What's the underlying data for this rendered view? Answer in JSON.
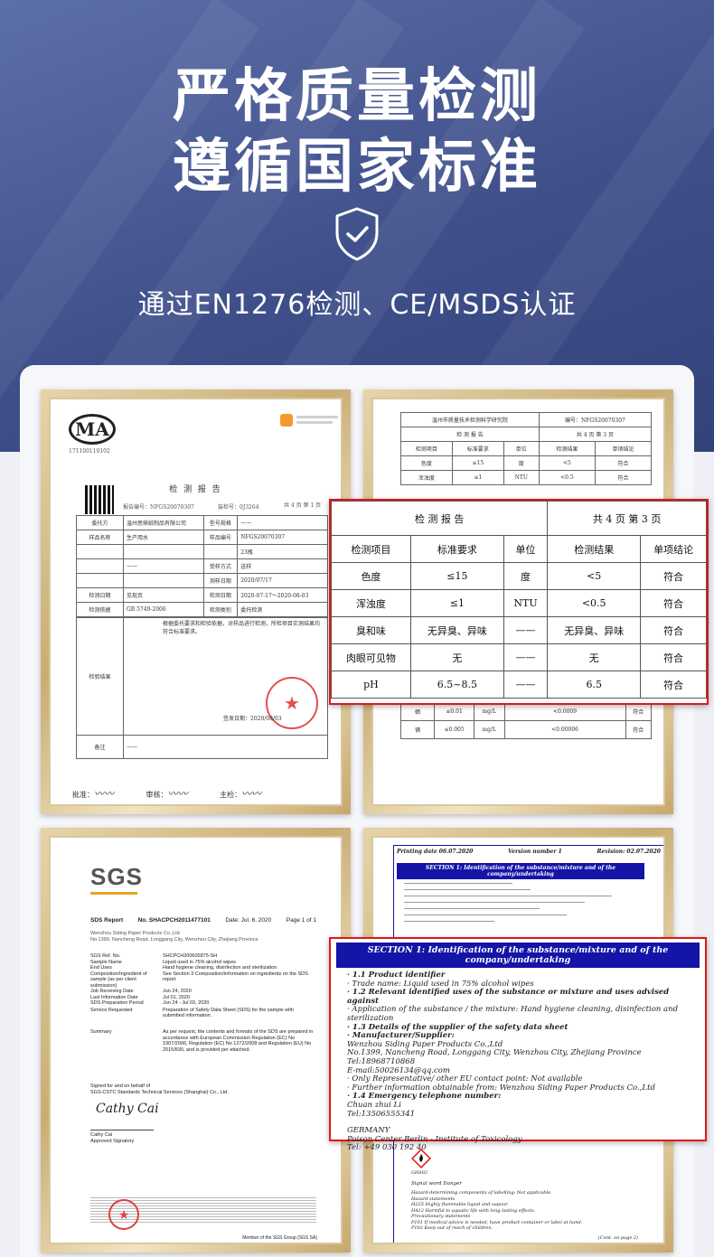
{
  "hero": {
    "title_line1": "严格质量检测",
    "title_line2": "遵循国家标准",
    "subtitle": "通过EN1276检测、CE/MSDS认证",
    "shield_icon": "shield-check-icon"
  },
  "cards": {
    "report1": {
      "logo": "MA",
      "logo_no": "171100110102",
      "title": "检 测 报 告",
      "report_no_label": "报告编号：",
      "report_no": "NFGS20070307",
      "receive_label": "装检号：",
      "receive_no": "0J3264",
      "pages": "共 4 页 第 1 页",
      "rows": [
        [
          "委托方",
          "温州思鼎纸制品有限公司",
          "型号规格",
          "——"
        ],
        [
          "样品名称",
          "生产用水",
          "样品编号",
          "NFGS20070307"
        ],
        [
          "",
          "",
          "",
          "23瓶"
        ],
        [
          "",
          "——",
          "受样方式",
          "送样"
        ],
        [
          "",
          "",
          "测样日期",
          "2020/07/17"
        ],
        [
          "检测日期",
          "见现页",
          "检测日期",
          "2020-07-17～2020-08-03"
        ],
        [
          "检测依据",
          "GB 5749-2006",
          "检测类别",
          "委托检测"
        ]
      ],
      "conclusion_label": "检验结果",
      "conclusion_text": "根据委托要求和检验依据，对样品进行检测，所检项目实测结果均符合标准要求。",
      "issue_date_label": "签发日期：",
      "issue_date": "2020/08/03",
      "remark_label": "备注",
      "remark": "——",
      "sign_labels": [
        "批准：",
        "审核：",
        "主检："
      ]
    },
    "report2": {
      "org": "温州市质量技术检测科学研究院",
      "no": "编号：NFGS20070307",
      "title": "检 测 报 告",
      "pages": "共 4 页 第 3 页",
      "headers": [
        "检测项目",
        "标准要求",
        "单位",
        "检测结果",
        "单项结论"
      ],
      "rows_top": [
        [
          "色度",
          "≤15",
          "度",
          "<5",
          "符合"
        ],
        [
          "浑浊度",
          "≤1",
          "NTU",
          "<0.5",
          "符合"
        ]
      ],
      "rows_bottom": [
        [
          "氟化物",
          "≤1.0",
          "mg/L",
          "未检出（定量限：0.01mg/L）",
          "符合"
        ],
        [
          "氰化物",
          "≤0.05",
          "mg/L",
          "<0.002",
          "符合"
        ],
        [
          "砷",
          "≤0.01",
          "mg/L",
          "<0.0009",
          "符合"
        ],
        [
          "硒",
          "≤0.01",
          "mg/L",
          "<0.0009",
          "符合"
        ],
        [
          "镉",
          "≤0.005",
          "mg/L",
          "<0.00006",
          "符合"
        ]
      ]
    },
    "zoom1": {
      "title": "检 测 报 告",
      "pages": "共 4 页 第 3 页",
      "headers": [
        "检测项目",
        "标准要求",
        "单位",
        "检测结果",
        "单项结论"
      ],
      "rows": [
        [
          "色度",
          "≤15",
          "度",
          "<5",
          "符合"
        ],
        [
          "浑浊度",
          "≤1",
          "NTU",
          "<0.5",
          "符合"
        ],
        [
          "臭和味",
          "无异臭、异味",
          "——",
          "无异臭、异味",
          "符合"
        ],
        [
          "肉眼可见物",
          "无",
          "——",
          "无",
          "符合"
        ],
        [
          "pH",
          "6.5~8.5",
          "——",
          "6.5",
          "符合"
        ]
      ]
    },
    "sgs": {
      "logo": "SGS",
      "report_title": "SDS Report",
      "report_no": "No. SHACPCH2011477101",
      "date": "Date: Jul. 6, 2020",
      "page": "Page 1 of 1",
      "company": "Wenzhou Siding Paper Products Co.,Ltd",
      "address": "No.1399, Nancheng Road, Longgang City, Wenzhou City, Zhejiang Province",
      "fields": [
        [
          "SGS Ref. No.",
          "SHCPCH200605875-SH"
        ],
        [
          "Sample Name",
          "Liquid used in 75% alcohol wipes"
        ],
        [
          "End Uses",
          "Hand hygiene cleaning, disinfection and sterilization"
        ],
        [
          "Composition/Ingredient of sample (as per client submission)",
          "See Section 3 Composition/information on ingredients on the SDS report"
        ],
        [
          "Job Receiving Date",
          "Jun 24, 2020"
        ],
        [
          "Last Information Date",
          "Jul 01, 2020"
        ],
        [
          "SDS Preparation Period",
          "Jun 24 - Jul 03, 2020"
        ]
      ],
      "service_label": "Service Requested",
      "service": "Preparation of Safety Data Sheet (SDS) for the sample with submitted information.",
      "summary_label": "Summary",
      "summary": "As per request, the contents and formats of the SDS are prepared in accordance with European Commission Regulation (EC) No 1907/2006, Regulation (EC) No 1272/2008 and Regulation (EU) No 2015/830, and is provided per attached.",
      "signed": "Signed for and on behalf of",
      "signed_org": "SGS-CSTC Standards Technical Services (Shanghai) Co., Ltd.",
      "signature": "Cathy Cai",
      "signer": "Cathy Cai",
      "signer_title": "Approved Signatory",
      "member": "Member of the SGS Group (SGS SA)"
    },
    "msds": {
      "printing_date": "Printing date 06.07.2020",
      "version": "Version number 1",
      "revision": "Revision: 02.07.2020",
      "section_bar": "SECTION 1: Identification of the substance/mixture and of the company/undertaking",
      "ghs": "GHS02",
      "signal_word": "Signal word Danger",
      "lower_lines": [
        "Hazard-determining components of labelling: Not applicable.",
        "Hazard statements",
        "H225 Highly flammable liquid and vapour.",
        "H412 Harmful to aquatic life with long lasting effects.",
        "Precautionary statements",
        "P101    If medical advice is needed, have product container or label at hand.",
        "P102    Keep out of reach of children."
      ],
      "cont": "(Cont. on page 2)"
    },
    "zoom2": {
      "section_bar": "SECTION 1: Identification of the substance/mixture and of the company/undertaking",
      "lines": [
        {
          "t": "· 1.1 Product identifier",
          "b": true
        },
        {
          "t": "· Trade name: Liquid used in 75% alcohol wipes",
          "b": false
        },
        {
          "t": "· 1.2 Relevant identified uses of the substance or mixture and uses advised against",
          "b": true
        },
        {
          "t": "· Application of the substance / the mixture: Hand hygiene cleaning, disinfection and sterilization",
          "b": false
        },
        {
          "t": "· 1.3 Details of the supplier of the safety data sheet",
          "b": true
        },
        {
          "t": "· Manufacturer/Supplier:",
          "b": true
        },
        {
          "t": "Wenzhou Siding Paper Products Co.,Ltd",
          "b": false
        },
        {
          "t": "No.1399, Nancheng Road, Longgang City, Wenzhou City, Zhejiang Province",
          "b": false
        },
        {
          "t": "Tel:18968710868",
          "b": false
        },
        {
          "t": "E-mail:50026134@qq.com",
          "b": false
        },
        {
          "t": "· Only Representative/ other EU contact point: Not available",
          "b": false
        },
        {
          "t": "· Further information obtainable from: Wenzhou Siding Paper Products Co.,Ltd",
          "b": false
        },
        {
          "t": "· 1.4 Emergency telephone number:",
          "b": true
        },
        {
          "t": "Chuan zhui Li",
          "b": false
        },
        {
          "t": "Tel:13506555341",
          "b": false
        },
        {
          "t": "",
          "b": false
        },
        {
          "t": "GERMANY",
          "b": false
        },
        {
          "t": "Poison Center Berlin - Institute of Toxicology",
          "b": false
        },
        {
          "t": "Tel: +49 030 192 40",
          "b": false
        }
      ]
    }
  },
  "colors": {
    "hero_bg": "#3f4f8a",
    "zoom_border": "#e01818",
    "section_bar": "#1414a8",
    "frame_gold": "#c9ad74"
  }
}
